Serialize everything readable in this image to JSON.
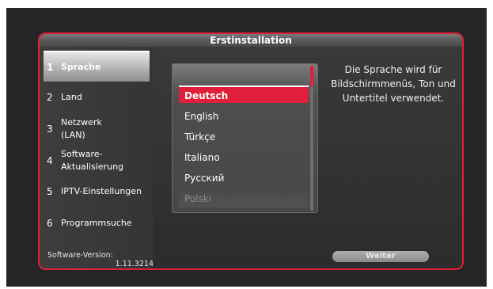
{
  "dialog": {
    "title": "Erstinstallation"
  },
  "sidebar": {
    "steps": [
      {
        "num": "1",
        "label": "Sprache",
        "active": true
      },
      {
        "num": "2",
        "label": "Land"
      },
      {
        "num": "3",
        "label": "Netzwerk (LAN)"
      },
      {
        "num": "4",
        "label": "Software-Aktualisierung"
      },
      {
        "num": "5",
        "label": "IPTV-Einstellungen"
      },
      {
        "num": "6",
        "label": "Programmsuche"
      }
    ],
    "version_label": "Software-Version:",
    "version_value": "1.11.3214"
  },
  "language_list": {
    "options": [
      "Deutsch",
      "English",
      "Türkçe",
      "Italiano",
      "Русский",
      "Polski"
    ],
    "selected": "Deutsch"
  },
  "help_text": "Die Sprache wird für Bildschirmmenüs, Ton und Untertitel verwendet.",
  "buttons": {
    "next": "Weiter"
  },
  "colors": {
    "accent": "#e0203a",
    "background": "#252525"
  }
}
